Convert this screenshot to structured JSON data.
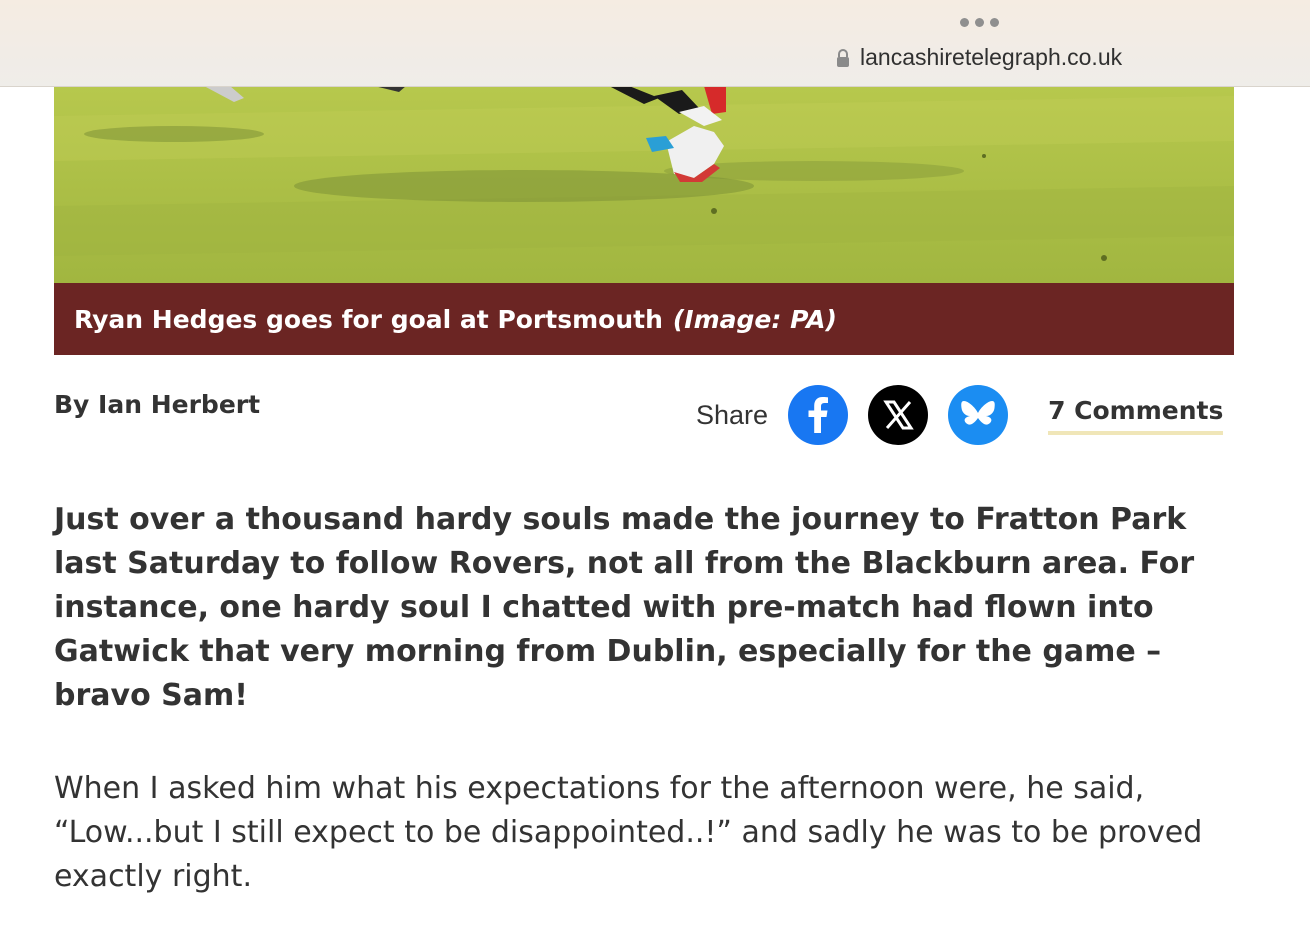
{
  "browser": {
    "url": "lancashiretelegraph.co.uk",
    "menu_icon": "more-dots-icon"
  },
  "article": {
    "image_caption": "Ryan Hedges goes for goal at Portsmouth",
    "image_credit": "(Image: PA)",
    "byline": "By Ian Herbert",
    "share_label": "Share",
    "share_icons": [
      "facebook-icon",
      "x-icon",
      "bluesky-icon"
    ],
    "comments_label": "7 Comments",
    "paragraphs": [
      "Just over a thousand hardy souls made the journey to Fratton Park last Saturday to follow Rovers, not all from the Blackburn area. For instance, one hardy soul I chatted with pre-match had flown into Gatwick that very morning from Dublin, especially for the game – bravo Sam!",
      "When I asked him what his expectations for the afternoon were, he said, “Low...but I still expect to be disappointed..!” and sadly he was to be proved exactly right."
    ]
  },
  "colors": {
    "caption_bg": "#6b2523",
    "facebook": "#1877f2",
    "x": "#000000",
    "bluesky": "#1b8df2",
    "comments_underline": "#f0e6b8"
  }
}
